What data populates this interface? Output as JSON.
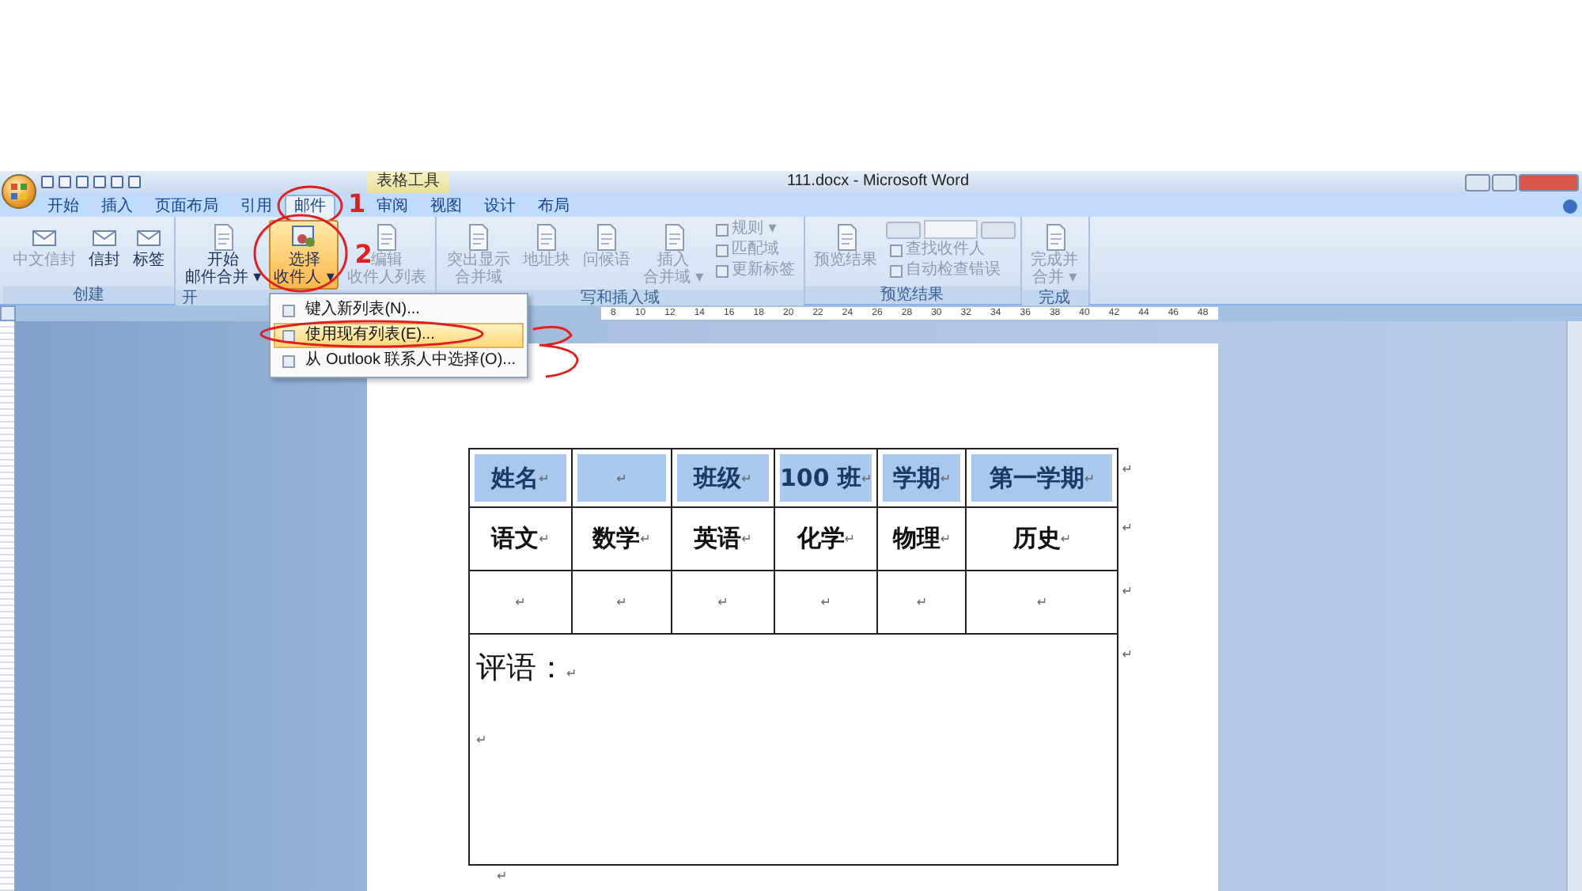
{
  "window": {
    "title": "111.docx - Microsoft Word",
    "context_tab": "表格工具"
  },
  "tabs": [
    {
      "label": "开始",
      "selected": false
    },
    {
      "label": "插入",
      "selected": false
    },
    {
      "label": "页面布局",
      "selected": false
    },
    {
      "label": "引用",
      "selected": false
    },
    {
      "label": "邮件",
      "selected": true
    },
    {
      "label": "审阅",
      "selected": false
    },
    {
      "label": "视图",
      "selected": false
    },
    {
      "label": "设计",
      "selected": false
    },
    {
      "label": "布局",
      "selected": false
    }
  ],
  "ribbon_groups": [
    {
      "label": "创建",
      "buttons": [
        {
          "kind": "large",
          "lines": [
            "中文信封"
          ],
          "disabled": true,
          "active": false
        },
        {
          "kind": "large",
          "lines": [
            "信封"
          ],
          "disabled": false,
          "active": false
        },
        {
          "kind": "large",
          "lines": [
            "标签"
          ],
          "disabled": false,
          "active": false
        }
      ]
    },
    {
      "label": "开",
      "buttons": [
        {
          "kind": "large",
          "lines": [
            "开始",
            "邮件合并 ▾"
          ],
          "disabled": false,
          "active": false
        },
        {
          "kind": "large",
          "lines": [
            "选择",
            "收件人 ▾"
          ],
          "disabled": false,
          "active": true
        },
        {
          "kind": "large",
          "lines": [
            "编辑",
            "收件人列表"
          ],
          "disabled": true,
          "active": false
        }
      ]
    },
    {
      "label": "写和插入域",
      "buttons": [
        {
          "kind": "large",
          "lines": [
            "突出显示",
            "合并域"
          ],
          "disabled": true,
          "active": false
        },
        {
          "kind": "large",
          "lines": [
            "地址块"
          ],
          "disabled": true,
          "active": false
        },
        {
          "kind": "large",
          "lines": [
            "问候语"
          ],
          "disabled": true,
          "active": false
        },
        {
          "kind": "large",
          "lines": [
            "插入",
            "合并域 ▾"
          ],
          "disabled": true,
          "active": false
        },
        {
          "kind": "small",
          "lines": [
            "规则 ▾",
            "匹配域",
            "更新标签"
          ],
          "disabled": true
        }
      ]
    },
    {
      "label": "预览结果",
      "buttons": [
        {
          "kind": "large",
          "lines": [
            "预览结果"
          ],
          "disabled": true,
          "active": false
        },
        {
          "kind": "nav",
          "lines": [
            "查找收件人",
            "自动检查错误"
          ],
          "disabled": true
        }
      ]
    },
    {
      "label": "完成",
      "buttons": [
        {
          "kind": "large",
          "lines": [
            "完成并",
            "合并 ▾"
          ],
          "disabled": true,
          "active": false
        }
      ]
    }
  ],
  "menu": [
    {
      "label": "键入新列表(N)...",
      "selected": false
    },
    {
      "label": "使用现有列表(E)...",
      "selected": true
    },
    {
      "label": "从 Outlook 联系人中选择(O)...",
      "selected": false
    }
  ],
  "annotations": [
    {
      "text": "1"
    },
    {
      "text": "2"
    }
  ],
  "ruler": [
    "8",
    "10",
    "12",
    "14",
    "16",
    "18",
    "20",
    "22",
    "24",
    "26",
    "28",
    "30",
    "32",
    "34",
    "36",
    "38",
    "40",
    "42",
    "44",
    "46",
    "48"
  ],
  "table": {
    "rows": [
      {
        "selected": true,
        "end_mark": "↵",
        "cells": [
          {
            "text": "姓名",
            "mark": "↵"
          },
          {
            "mark": "↵"
          },
          {
            "text": "班级",
            "mark": "↵"
          },
          {
            "text": "100 班",
            "mark": "↵"
          },
          {
            "text": "学期",
            "mark": "↵"
          },
          {
            "text": "第一学期",
            "mark": "↵"
          }
        ]
      },
      {
        "selected": false,
        "end_mark": "↵",
        "cells": [
          {
            "text": "语文",
            "mark": "↵"
          },
          {
            "text": "数学",
            "mark": "↵"
          },
          {
            "text": "英语",
            "mark": "↵"
          },
          {
            "text": "化学",
            "mark": "↵"
          },
          {
            "text": "物理",
            "mark": "↵"
          },
          {
            "text": "历史",
            "mark": "↵"
          }
        ]
      },
      {
        "selected": false,
        "end_mark": "↵",
        "cells": [
          {
            "mark": "↵"
          },
          {
            "mark": "↵"
          },
          {
            "mark": "↵"
          },
          {
            "mark": "↵"
          },
          {
            "mark": "↵"
          },
          {
            "mark": "↵"
          }
        ]
      }
    ],
    "comment": {
      "label": "评语：",
      "mark": "↵",
      "second_mark": "↵",
      "end_mark": "↵"
    },
    "after_mark": "↵"
  }
}
